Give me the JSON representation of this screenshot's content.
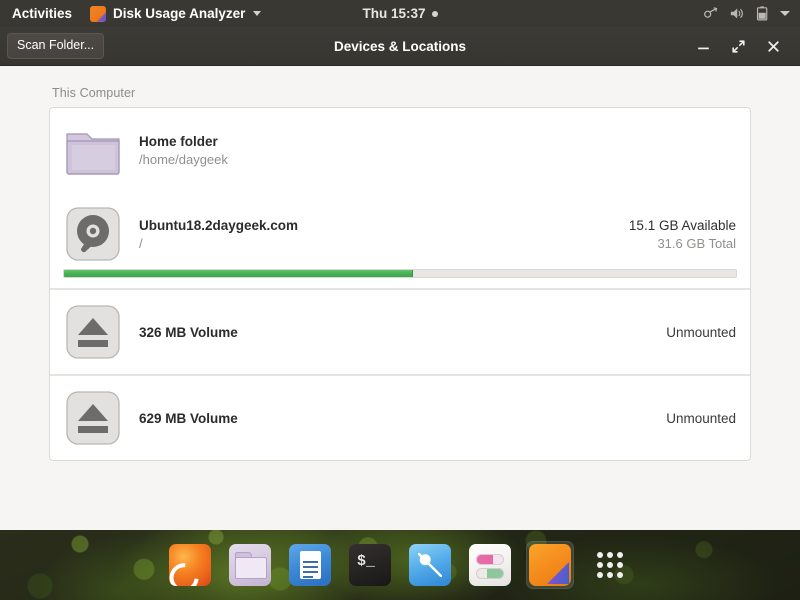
{
  "topbar": {
    "activities": "Activities",
    "app_name": "Disk Usage Analyzer",
    "app_icon": "disk-usage-analyzer-icon",
    "clock": "Thu 15:37",
    "tray": {
      "network_icon": "network-vpn-icon",
      "volume_icon": "volume-speaker-icon",
      "battery_icon": "battery-icon",
      "menu_icon": "chevron-down-icon"
    }
  },
  "window": {
    "scan_button": "Scan Folder...",
    "title": "Devices & Locations",
    "controls": {
      "minimize": "minimize-icon",
      "maximize": "maximize-icon",
      "close": "close-icon"
    }
  },
  "content": {
    "section_label": "This Computer",
    "rows": [
      {
        "icon": "home-folder-icon",
        "title": "Home folder",
        "subtitle": "/home/daygeek",
        "right_primary": "",
        "right_secondary": ""
      },
      {
        "icon": "hard-disk-icon",
        "title": "Ubuntu18.2daygeek.com",
        "subtitle": "/",
        "right_primary": "15.1 GB Available",
        "right_secondary": "31.6 GB Total"
      },
      {
        "icon": "eject-volume-icon",
        "title": "326 MB Volume",
        "subtitle": "",
        "right_primary": "Unmounted",
        "right_secondary": ""
      },
      {
        "icon": "eject-volume-icon",
        "title": "629 MB Volume",
        "subtitle": "",
        "right_primary": "Unmounted",
        "right_secondary": ""
      }
    ],
    "usage_bar": {
      "percent_used": 52,
      "fill_color": "#45b153",
      "track_color": "#e9e7e5"
    }
  },
  "dock": {
    "items": [
      {
        "name": "firefox",
        "label": "Firefox",
        "active": false
      },
      {
        "name": "files",
        "label": "Files",
        "active": false
      },
      {
        "name": "text-editor",
        "label": "Text Editor",
        "active": false
      },
      {
        "name": "terminal",
        "label": "Terminal",
        "active": false
      },
      {
        "name": "software",
        "label": "Ubuntu Software",
        "active": false
      },
      {
        "name": "settings",
        "label": "Settings",
        "active": false
      },
      {
        "name": "disk-usage-analyzer",
        "label": "Disk Usage Analyzer",
        "active": true
      },
      {
        "name": "show-applications",
        "label": "Show Applications",
        "active": false
      }
    ]
  },
  "colors": {
    "topbar_bg": "#3a3833",
    "headerbar_bg": "#37352f",
    "window_bg": "#f6f5f4",
    "panel_bg": "#ffffff",
    "accent_green": "#45b153",
    "folder_purple": "#c9bfd4"
  }
}
